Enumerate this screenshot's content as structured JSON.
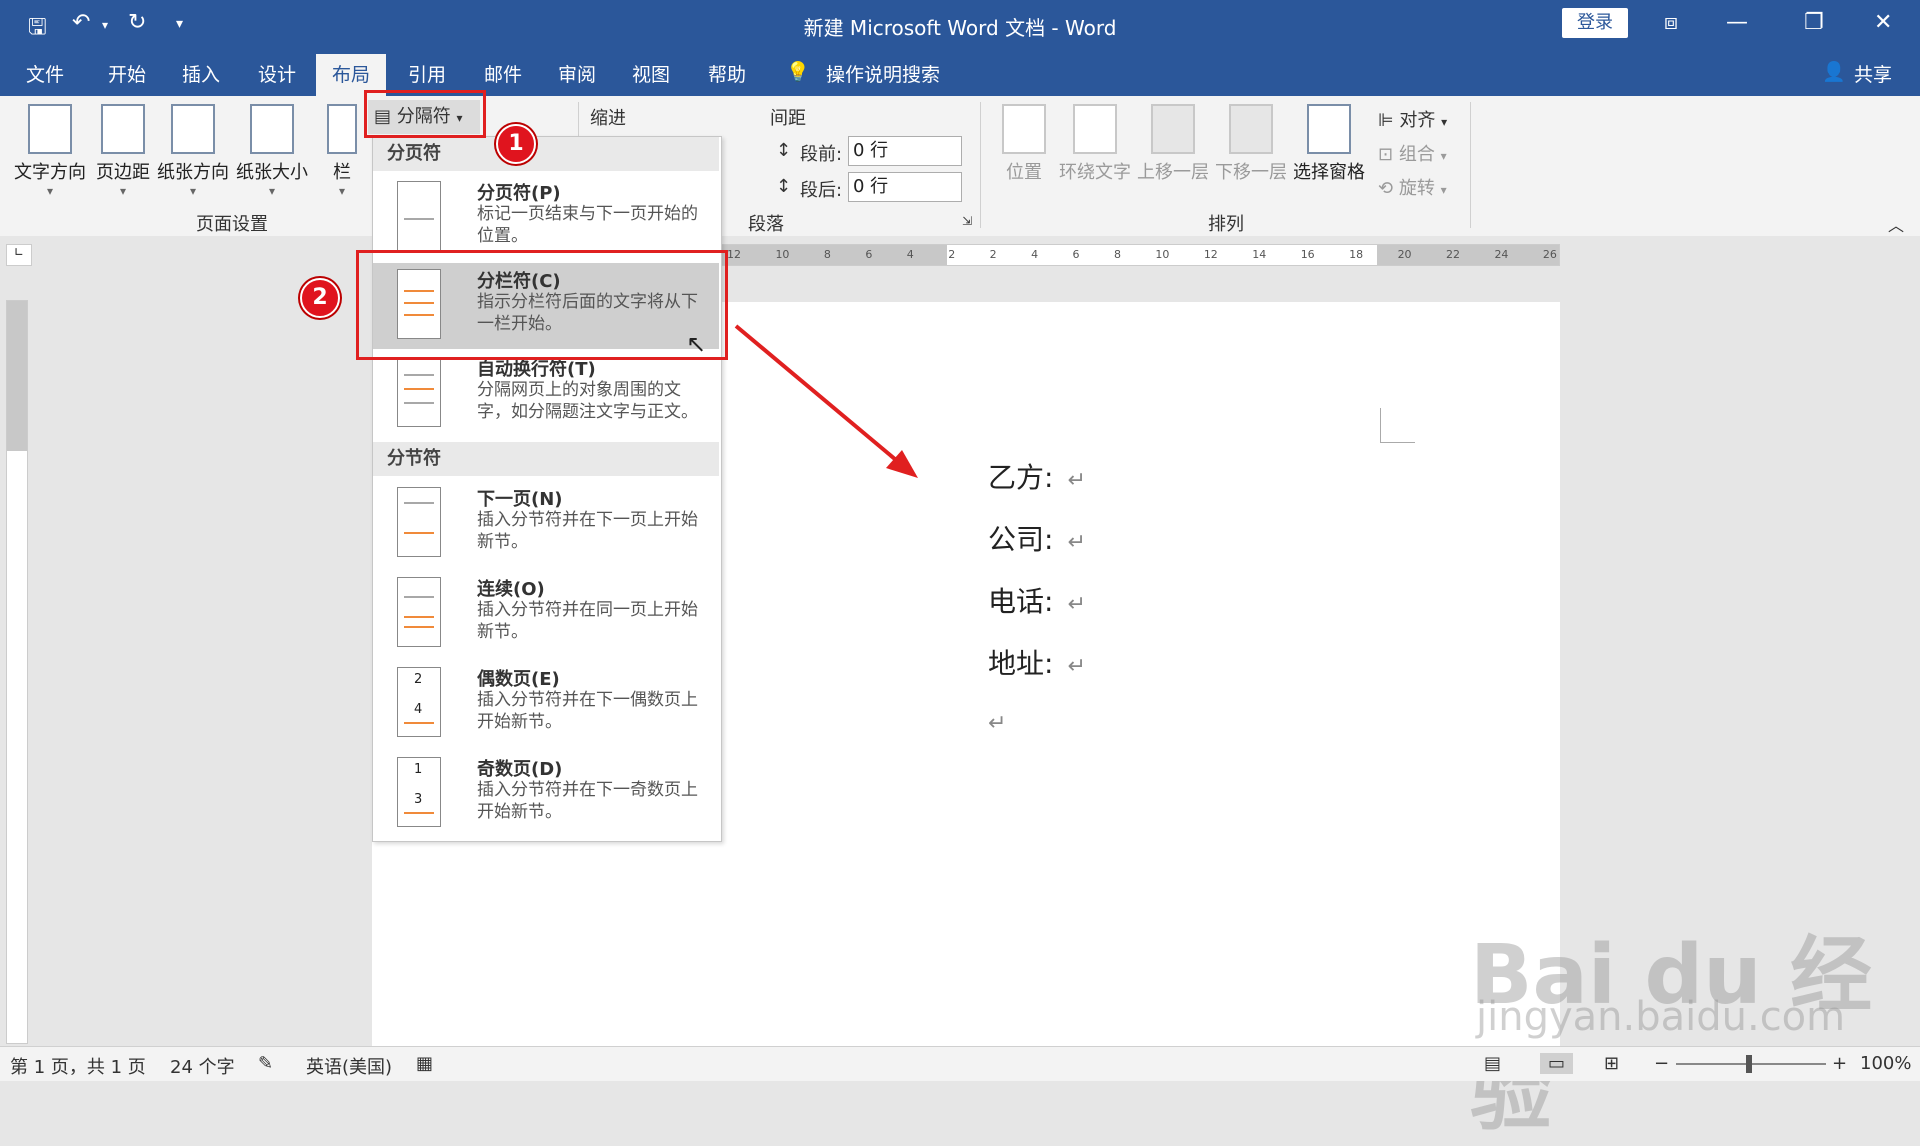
{
  "window": {
    "title": "新建 Microsoft Word 文档  -  Word",
    "login": "登录"
  },
  "menu_tabs": [
    "文件",
    "开始",
    "插入",
    "设计",
    "布局",
    "引用",
    "邮件",
    "审阅",
    "视图",
    "帮助"
  ],
  "search_hint": "操作说明搜索",
  "share": "共享",
  "ribbon": {
    "page_setup": {
      "buttons": [
        "文字方向",
        "页边距",
        "纸张方向",
        "纸张大小",
        "栏"
      ],
      "breaks_button": "分隔符",
      "group_label": "页面设置"
    },
    "paragraph": {
      "indent_label": "缩进",
      "spacing_label": "间距",
      "before_label": "段前:",
      "before_value": "0 行",
      "after_label": "段后:",
      "after_value": "0 行",
      "group_label": "段落"
    },
    "arrange": {
      "buttons": [
        "位置",
        "环绕文字",
        "上移一层",
        "下移一层",
        "选择窗格"
      ],
      "small": [
        "对齐",
        "组合",
        "旋转"
      ],
      "group_label": "排列"
    }
  },
  "ruler_ticks": [
    "12",
    "10",
    "8",
    "6",
    "4",
    "2",
    "2",
    "4",
    "6",
    "8",
    "10",
    "12",
    "14",
    "16",
    "18",
    "20",
    "22",
    "24",
    "26"
  ],
  "dropdown": {
    "section_page": "分页符",
    "section_section": "分节符",
    "items": [
      {
        "title": "分页符(P)",
        "desc": "标记一页结束与下一页开始的位置。"
      },
      {
        "title": "分栏符(C)",
        "desc": "指示分栏符后面的文字将从下一栏开始。"
      },
      {
        "title": "自动换行符(T)",
        "desc": "分隔网页上的对象周围的文字，如分隔题注文字与正文。"
      },
      {
        "title": "下一页(N)",
        "desc": "插入分节符并在下一页上开始新节。"
      },
      {
        "title": "连续(O)",
        "desc": "插入分节符并在同一页上开始新节。"
      },
      {
        "title": "偶数页(E)",
        "desc": "插入分节符并在下一偶数页上开始新节。"
      },
      {
        "title": "奇数页(D)",
        "desc": "插入分节符并在下一奇数页上开始新节。"
      }
    ],
    "icon_labels": {
      "even_top": "2",
      "even_bottom": "4",
      "odd_top": "1",
      "odd_bottom": "3"
    }
  },
  "badges": [
    "1",
    "2"
  ],
  "document": {
    "lines": [
      "乙方:",
      "公司:",
      "电话:",
      "地址:"
    ],
    "para_mark": "↵"
  },
  "status": {
    "page": "第 1 页，共 1 页",
    "words": "24 个字",
    "language": "英语(美国)",
    "zoom": "100%"
  },
  "watermark": {
    "brand": "Bai du 经验",
    "url": "jingyan.baidu.com"
  },
  "colors": {
    "title_bar": "#2b579a",
    "highlight": "#e02020"
  }
}
